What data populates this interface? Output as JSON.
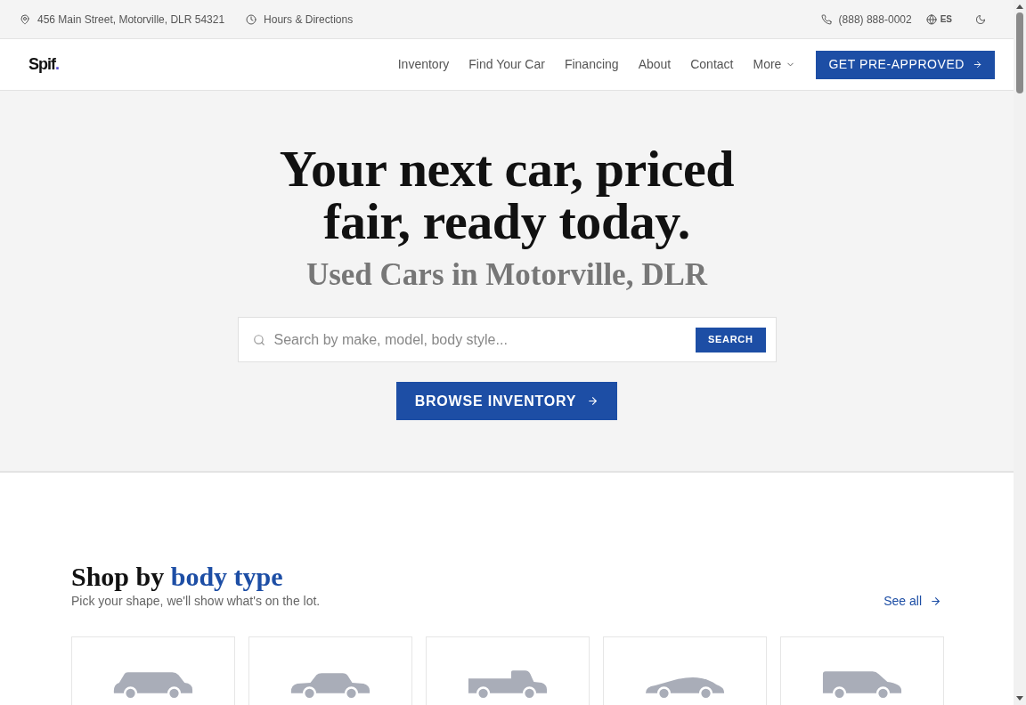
{
  "top_bar": {
    "address": "456 Main Street, Motorville, DLR 54321",
    "hours_link": "Hours & Directions",
    "phone": "(888) 888-0002",
    "language": "ES"
  },
  "navbar": {
    "logo": {
      "name": "Spif",
      "dot": "."
    },
    "links": [
      "Inventory",
      "Find Your Car",
      "Financing",
      "About",
      "Contact"
    ],
    "more": "More",
    "cta": "GET PRE-APPROVED"
  },
  "hero": {
    "title": "Your next car, priced fair, ready today.",
    "subtitle": "Used Cars in Motorville, DLR",
    "search": {
      "placeholder": "Search by make, model, body style...",
      "button": "SEARCH"
    },
    "browse_button": "BROWSE INVENTORY"
  },
  "body_types": {
    "heading": {
      "lead": "Shop by",
      "accent": "body type"
    },
    "subtitle": "Pick your shape, we'll show what's on the lot.",
    "see_all": "See all",
    "cards": [
      {
        "kind": "wagon"
      },
      {
        "kind": "sedan"
      },
      {
        "kind": "pickup"
      },
      {
        "kind": "sports"
      },
      {
        "kind": "van"
      }
    ]
  }
}
